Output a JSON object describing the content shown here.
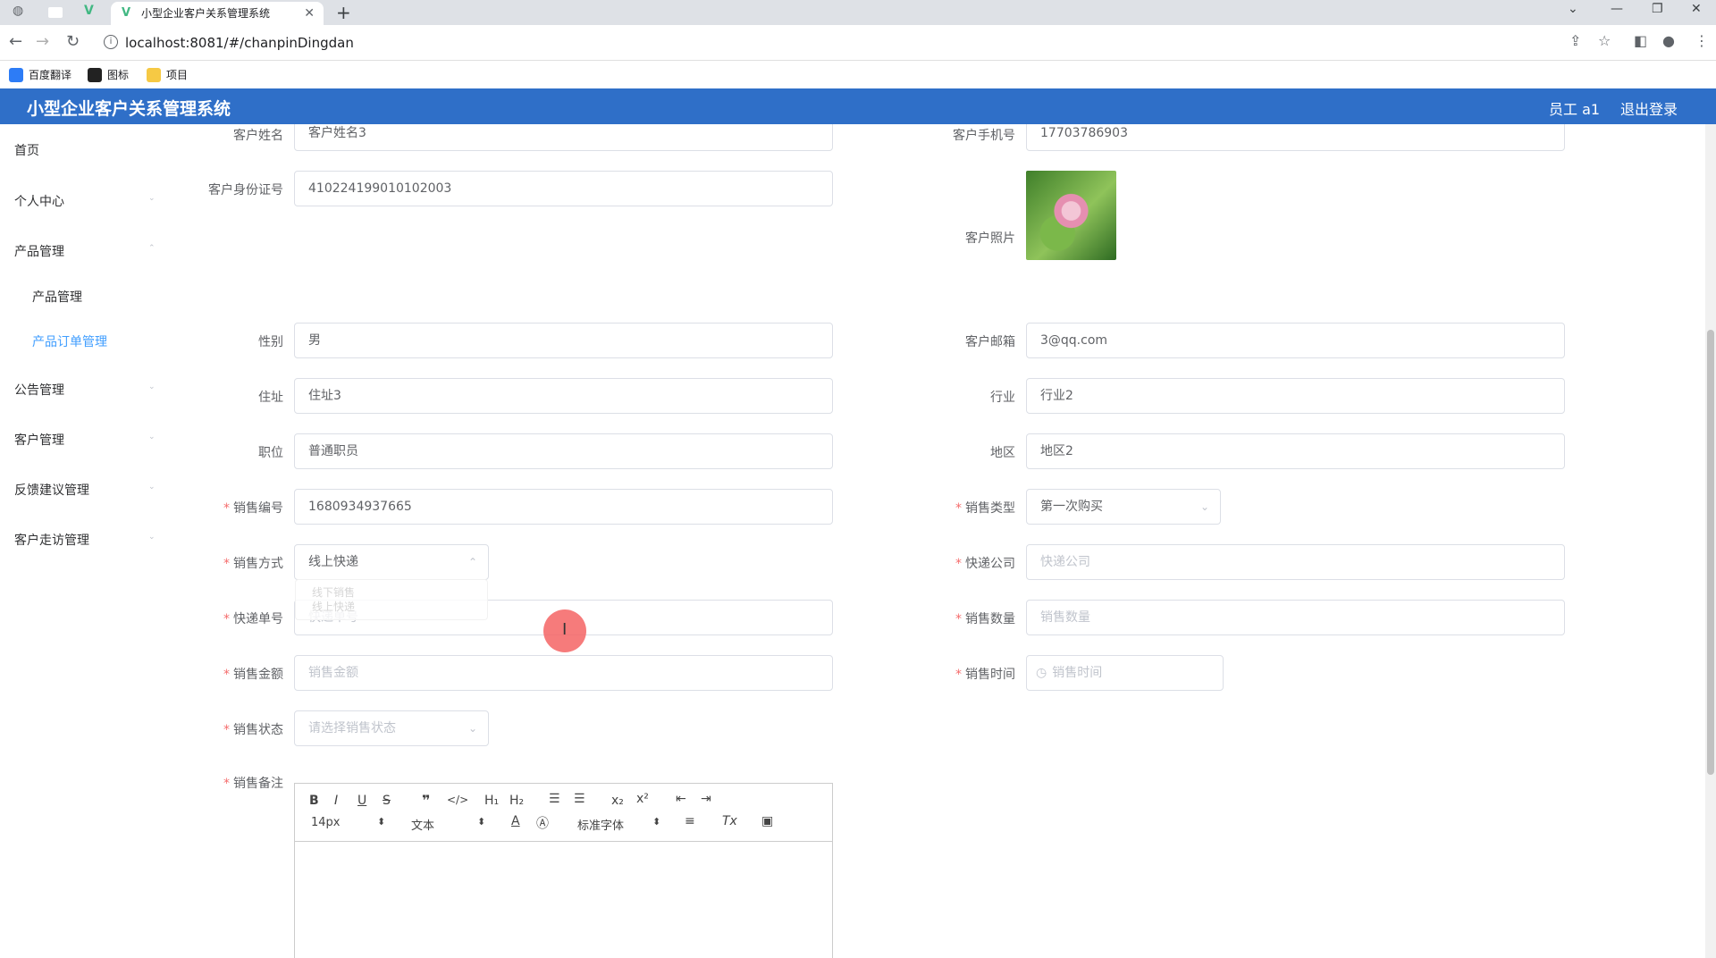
{
  "browser": {
    "tab_title": "小型企业客户关系管理系统",
    "url": "localhost:8081/#/chanpinDingdan",
    "bookmarks": [
      "百度翻译",
      "图标",
      "项目"
    ]
  },
  "header": {
    "title": "小型企业客户关系管理系统",
    "user": "员工 a1",
    "logout": "退出登录"
  },
  "sidebar": {
    "items": [
      "首页",
      "个人中心",
      "产品管理",
      "公告管理",
      "客户管理",
      "反馈建议管理",
      "客户走访管理"
    ],
    "sub_items": [
      "产品管理",
      "产品订单管理"
    ]
  },
  "form": {
    "customer_name": {
      "label": "客户姓名",
      "value": "客户姓名3"
    },
    "customer_phone": {
      "label": "客户手机号",
      "value": "17703786903"
    },
    "customer_id": {
      "label": "客户身份证号",
      "value": "410224199010102003"
    },
    "customer_photo": {
      "label": "客户照片"
    },
    "gender": {
      "label": "性别",
      "value": "男"
    },
    "email": {
      "label": "客户邮箱",
      "value": "3@qq.com"
    },
    "address": {
      "label": "住址",
      "value": "住址3"
    },
    "industry": {
      "label": "行业",
      "value": "行业2"
    },
    "position": {
      "label": "职位",
      "value": "普通职员"
    },
    "region": {
      "label": "地区",
      "value": "地区2"
    },
    "sale_no": {
      "label": "销售编号",
      "value": "1680934937665"
    },
    "sale_type": {
      "label": "销售类型",
      "value": "第一次购买"
    },
    "sale_method": {
      "label": "销售方式",
      "value": "线上快递"
    },
    "express_company": {
      "label": "快递公司",
      "placeholder": "快递公司"
    },
    "tracking_no": {
      "label": "快递单号",
      "placeholder": "快递单号"
    },
    "sale_qty": {
      "label": "销售数量",
      "placeholder": "销售数量"
    },
    "sale_amount": {
      "label": "销售金额",
      "placeholder": "销售金额"
    },
    "sale_time": {
      "label": "销售时间",
      "placeholder": "销售时间"
    },
    "sale_status": {
      "label": "销售状态",
      "placeholder": "请选择销售状态"
    },
    "sale_remark": {
      "label": "销售备注"
    },
    "required_mark": "*"
  },
  "dropdown_ghost": [
    "线下销售",
    "线上快递"
  ],
  "editor": {
    "font_size": "14px",
    "text_style": "文本",
    "font_family": "标准字体"
  },
  "colors": {
    "header_bg": "#2f6fc8",
    "active_menu": "#409eff",
    "required": "#f56c6c"
  }
}
